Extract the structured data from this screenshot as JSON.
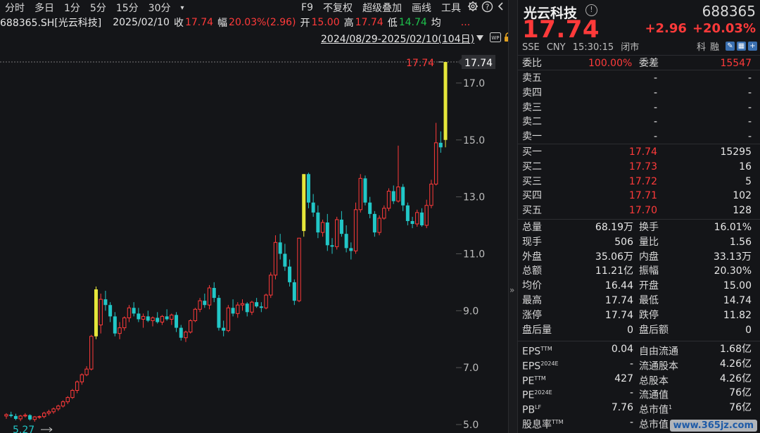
{
  "toolbar": {
    "items": [
      "分时",
      "多日",
      "1分",
      "5分",
      "15分",
      "30分",
      "▾"
    ],
    "right_items": [
      "F9",
      "不复权",
      "超级叠加",
      "画线",
      "工具"
    ],
    "icons": [
      "gear-icon",
      "help-icon",
      "chevron-left-icon"
    ],
    "more": "..."
  },
  "info": {
    "symbol": "688365.SH[光云科技]",
    "date": "2025/02/10",
    "close_label": "收",
    "close": "17.74",
    "amp_label": "幅",
    "amp": "20.03%(2.96)",
    "open_label": "开",
    "open": "15.00",
    "high_label": "高",
    "high": "17.74",
    "low_label": "低",
    "low": "14.74",
    "avg_label": "均"
  },
  "range": {
    "label": "2024/08/29-2025/02/10(104日)"
  },
  "stock": {
    "name": "光云科技",
    "code": "688365",
    "price": "17.74",
    "change": "+2.96",
    "change_pct": "+20.03%",
    "exchange": "SSE",
    "currency": "CNY",
    "time": "15:30:15",
    "status": "闭市",
    "tag1": "科",
    "tag2": "融"
  },
  "weibi": {
    "l1": "委比",
    "v1": "100.00%",
    "l2": "委差",
    "v2": "15547"
  },
  "asks": [
    {
      "label": "卖五",
      "price": "-",
      "vol": "-"
    },
    {
      "label": "卖四",
      "price": "-",
      "vol": "-"
    },
    {
      "label": "卖三",
      "price": "-",
      "vol": "-"
    },
    {
      "label": "卖二",
      "price": "-",
      "vol": "-"
    },
    {
      "label": "卖一",
      "price": "-",
      "vol": "-"
    }
  ],
  "bids": [
    {
      "label": "买一",
      "price": "17.74",
      "vol": "15295"
    },
    {
      "label": "买二",
      "price": "17.73",
      "vol": "16"
    },
    {
      "label": "买三",
      "price": "17.72",
      "vol": "5"
    },
    {
      "label": "买四",
      "price": "17.71",
      "vol": "102"
    },
    {
      "label": "买五",
      "price": "17.70",
      "vol": "128"
    }
  ],
  "stats1": [
    {
      "l1": "总量",
      "v1": "68.19万",
      "c1": "white",
      "l2": "换手",
      "v2": "16.01%",
      "c2": "white"
    },
    {
      "l1": "现手",
      "v1": "506",
      "c1": "white",
      "l2": "量比",
      "v2": "1.56",
      "c2": "white"
    },
    {
      "l1": "外盘",
      "v1": "35.06万",
      "c1": "red",
      "l2": "内盘",
      "v2": "33.13万",
      "c2": "green"
    },
    {
      "l1": "总额",
      "v1": "11.21亿",
      "c1": "white",
      "l2": "振幅",
      "v2": "20.30%",
      "c2": "white"
    },
    {
      "l1": "均价",
      "v1": "16.44",
      "c1": "red",
      "l2": "开盘",
      "v2": "15.00",
      "c2": "red"
    },
    {
      "l1": "最高",
      "v1": "17.74",
      "c1": "red",
      "l2": "最低",
      "v2": "14.74",
      "c2": "green"
    },
    {
      "l1": "涨停",
      "v1": "17.74",
      "c1": "red",
      "l2": "跌停",
      "v2": "11.82",
      "c2": "green"
    },
    {
      "l1": "盘后量",
      "v1": "0",
      "c1": "white",
      "l2": "盘后额",
      "v2": "0",
      "c2": "white"
    }
  ],
  "stats2": [
    {
      "l1": "EPS",
      "s1": "TTM",
      "v1": "0.04",
      "l2": "自由流通",
      "s2": "",
      "v2": "1.68亿"
    },
    {
      "l1": "EPS",
      "s1": "2024E",
      "v1": "-",
      "l2": "流通股本",
      "s2": "",
      "v2": "4.26亿"
    },
    {
      "l1": "PE",
      "s1": "TTM",
      "v1": "427",
      "l2": "总股本",
      "s2": "",
      "v2": "4.26亿"
    },
    {
      "l1": "PE",
      "s1": "2024E",
      "v1": "-",
      "l2": "流通值",
      "s2": "",
      "v2": "76亿"
    },
    {
      "l1": "PB",
      "s1": "LF",
      "v1": "7.76",
      "l2": "总市值",
      "s2": "1",
      "v2": "76亿"
    },
    {
      "l1": "股息率",
      "s1": "TTM",
      "v1": "-",
      "l2": "总市值",
      "s2": "",
      "v2": ""
    }
  ],
  "watermark": "www.365jz.com",
  "colors": {
    "up": "#ff3a3a",
    "down": "#22c7c7",
    "limit": "#e6e63a",
    "bg": "#141518"
  },
  "chart_data": {
    "type": "candlestick",
    "y_ticks": [
      5.0,
      7.0,
      9.0,
      11.0,
      13.0,
      15.0,
      17.0
    ],
    "ylim": [
      4.9,
      17.95
    ],
    "last_price": 17.74,
    "last_label": "17.74",
    "min_label": "5.27",
    "max_label": "17.74",
    "candles": [
      [
        5.3,
        5.4,
        5.2,
        5.35
      ],
      [
        5.35,
        5.45,
        5.25,
        5.3
      ],
      [
        5.3,
        5.38,
        5.15,
        5.2
      ],
      [
        5.2,
        5.34,
        5.12,
        5.3
      ],
      [
        5.3,
        5.4,
        5.25,
        5.33
      ],
      [
        5.33,
        5.36,
        5.14,
        5.18
      ],
      [
        5.18,
        5.3,
        5.1,
        5.27
      ],
      [
        5.27,
        5.32,
        5.2,
        5.28
      ],
      [
        5.28,
        5.45,
        5.22,
        5.4
      ],
      [
        5.4,
        5.52,
        5.32,
        5.45
      ],
      [
        5.45,
        5.6,
        5.38,
        5.55
      ],
      [
        5.55,
        5.7,
        5.48,
        5.65
      ],
      [
        5.65,
        5.85,
        5.6,
        5.8
      ],
      [
        5.8,
        6.0,
        5.72,
        5.95
      ],
      [
        5.95,
        6.25,
        5.9,
        6.2
      ],
      [
        6.2,
        6.55,
        6.1,
        6.5
      ],
      [
        6.5,
        6.8,
        6.4,
        6.75
      ],
      [
        6.75,
        7.05,
        6.7,
        6.95
      ],
      [
        6.95,
        8.15,
        6.9,
        8.1
      ],
      [
        8.1,
        9.85,
        8.0,
        9.75
      ],
      [
        8.5,
        9.6,
        8.2,
        9.4
      ],
      [
        9.4,
        9.7,
        9.0,
        9.2
      ],
      [
        9.2,
        9.3,
        8.6,
        8.8
      ],
      [
        8.8,
        8.95,
        8.1,
        8.2
      ],
      [
        8.2,
        8.6,
        8.0,
        8.4
      ],
      [
        8.4,
        8.8,
        8.3,
        8.75
      ],
      [
        8.75,
        9.2,
        8.6,
        9.1
      ],
      [
        9.1,
        9.3,
        8.8,
        8.9
      ],
      [
        8.9,
        9.1,
        8.6,
        8.7
      ],
      [
        8.7,
        8.9,
        8.4,
        8.8
      ],
      [
        8.8,
        9.0,
        8.6,
        8.65
      ],
      [
        8.65,
        8.8,
        8.45,
        8.75
      ],
      [
        8.75,
        8.95,
        8.55,
        8.6
      ],
      [
        8.6,
        8.85,
        8.5,
        8.8
      ],
      [
        8.8,
        9.05,
        8.65,
        8.7
      ],
      [
        8.7,
        8.9,
        8.5,
        8.85
      ],
      [
        8.85,
        8.95,
        8.25,
        8.4
      ],
      [
        8.4,
        8.5,
        7.95,
        8.05
      ],
      [
        8.05,
        8.3,
        7.9,
        8.25
      ],
      [
        8.25,
        8.7,
        8.2,
        8.65
      ],
      [
        8.65,
        9.1,
        8.6,
        9.05
      ],
      [
        9.05,
        9.45,
        8.95,
        9.35
      ],
      [
        9.35,
        9.6,
        9.1,
        9.2
      ],
      [
        9.2,
        9.9,
        9.05,
        9.8
      ],
      [
        9.8,
        10.0,
        9.3,
        9.45
      ],
      [
        9.45,
        9.55,
        8.3,
        8.4
      ],
      [
        8.4,
        8.65,
        8.1,
        8.3
      ],
      [
        8.3,
        9.2,
        8.25,
        9.1
      ],
      [
        9.1,
        9.4,
        8.8,
        8.9
      ],
      [
        8.9,
        9.3,
        8.75,
        9.2
      ],
      [
        9.2,
        9.4,
        9.0,
        9.25
      ],
      [
        9.25,
        9.3,
        8.8,
        8.95
      ],
      [
        8.95,
        9.35,
        8.85,
        9.3
      ],
      [
        9.3,
        9.45,
        9.1,
        9.15
      ],
      [
        9.15,
        9.3,
        8.95,
        9.1
      ],
      [
        9.1,
        9.6,
        9.05,
        9.55
      ],
      [
        9.55,
        10.35,
        9.45,
        10.25
      ],
      [
        10.25,
        11.65,
        10.1,
        11.4
      ],
      [
        11.4,
        11.7,
        10.8,
        11.0
      ],
      [
        11.0,
        11.35,
        10.4,
        10.55
      ],
      [
        10.55,
        10.8,
        9.85,
        10.0
      ],
      [
        10.0,
        10.1,
        9.2,
        9.35
      ],
      [
        9.35,
        11.55,
        9.3,
        11.55
      ],
      [
        11.8,
        13.8,
        11.6,
        13.8
      ],
      [
        13.8,
        13.85,
        12.6,
        12.8
      ],
      [
        12.8,
        13.1,
        12.3,
        12.45
      ],
      [
        12.45,
        12.7,
        11.55,
        11.75
      ],
      [
        11.75,
        12.2,
        11.6,
        12.1
      ],
      [
        12.1,
        12.4,
        11.1,
        11.3
      ],
      [
        11.3,
        11.55,
        11.0,
        11.25
      ],
      [
        11.25,
        12.3,
        11.15,
        12.2
      ],
      [
        12.2,
        12.5,
        11.6,
        11.7
      ],
      [
        11.7,
        12.0,
        11.05,
        11.2
      ],
      [
        11.2,
        11.4,
        10.8,
        11.1
      ],
      [
        11.1,
        12.8,
        11.0,
        12.55
      ],
      [
        12.55,
        13.8,
        12.45,
        13.65
      ],
      [
        13.65,
        13.75,
        12.7,
        12.8
      ],
      [
        12.8,
        13.0,
        12.25,
        12.4
      ],
      [
        12.4,
        12.5,
        11.6,
        11.75
      ],
      [
        11.75,
        12.35,
        11.65,
        12.25
      ],
      [
        12.25,
        12.7,
        12.2,
        12.6
      ],
      [
        12.6,
        13.3,
        12.5,
        13.2
      ],
      [
        13.2,
        13.4,
        12.75,
        12.85
      ],
      [
        12.85,
        14.8,
        12.8,
        13.35
      ],
      [
        13.35,
        13.45,
        12.5,
        12.7
      ],
      [
        12.7,
        12.8,
        12.0,
        12.15
      ],
      [
        12.15,
        12.3,
        11.9,
        12.05
      ],
      [
        12.05,
        12.55,
        11.95,
        12.45
      ],
      [
        12.45,
        12.6,
        11.95,
        12.0
      ],
      [
        12.0,
        12.9,
        11.9,
        12.7
      ],
      [
        12.7,
        13.6,
        12.6,
        13.45
      ],
      [
        13.45,
        15.6,
        13.4,
        14.9
      ],
      [
        14.9,
        15.3,
        14.55,
        14.74
      ],
      [
        15.0,
        17.74,
        14.74,
        17.74
      ]
    ],
    "limit_up_idx": [
      19,
      63,
      93
    ]
  }
}
